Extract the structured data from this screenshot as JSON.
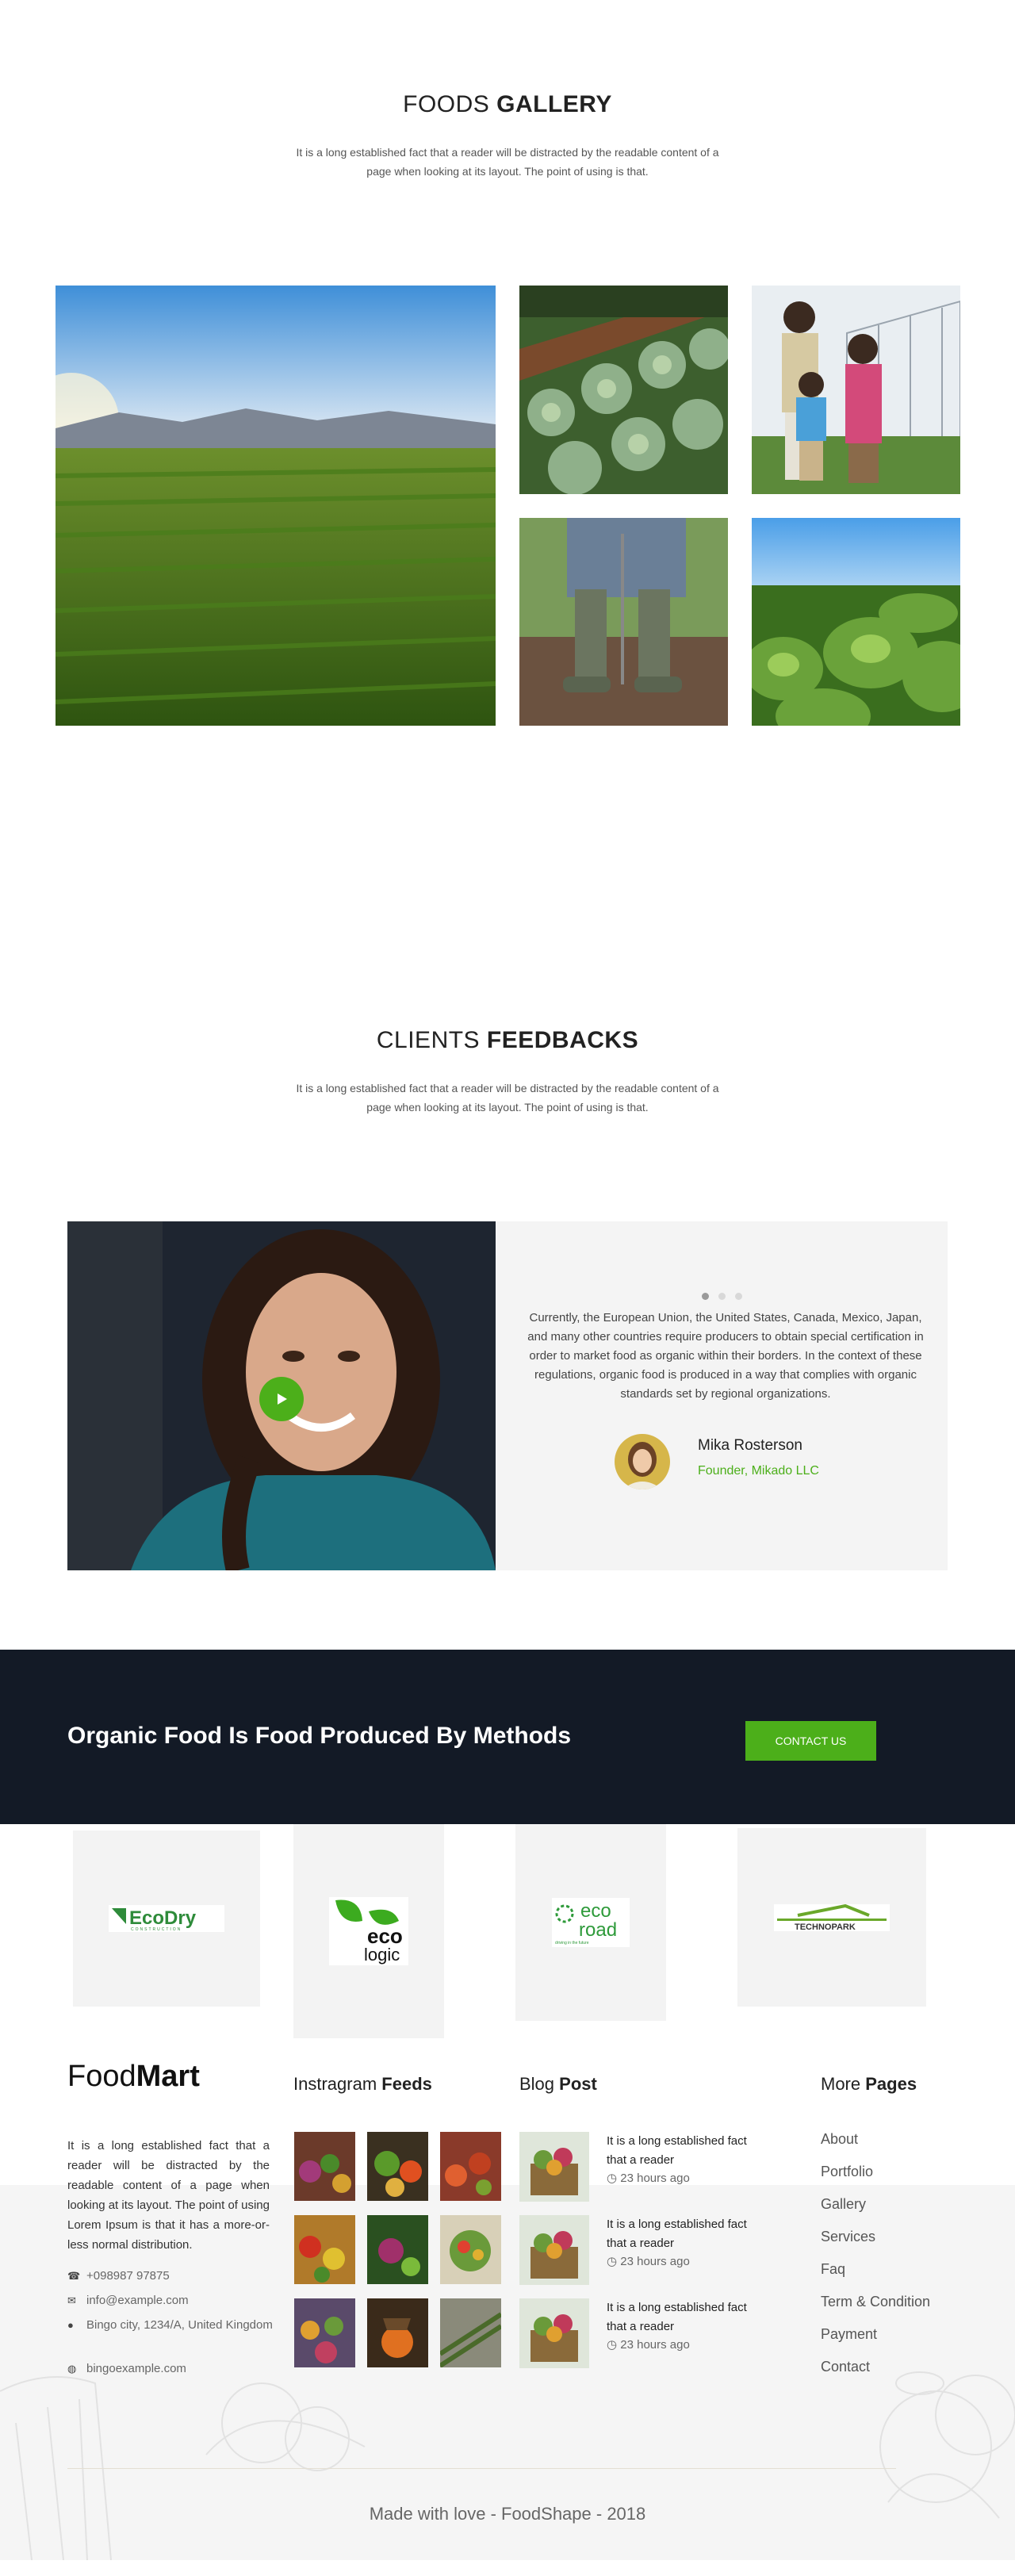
{
  "gallery": {
    "title_light": "FOODS",
    "title_bold": "GALLERY",
    "subtitle": "It is a long established fact that a reader will be distracted by the readable content of a page when looking at its layout. The point of using is that."
  },
  "feedback": {
    "title_light": "CLIENTS",
    "title_bold": "FEEDBACKS",
    "subtitle": "It is a long established fact that a reader will be distracted by the readable content of a page when looking at its layout. The point of using is that.",
    "quote": "Currently, the European Union, the United States, Canada, Mexico, Japan, and many other countries require producers to obtain special certification in order to market food as organic within their borders. In the context of these regulations, organic food is produced in a way that complies with organic standards set by regional organizations.",
    "name": "Mika Rosterson",
    "role": "Founder, Mikado LLC",
    "slides": 3,
    "active_slide": 1
  },
  "cta": {
    "text": "Organic Food Is Food Produced By Methods",
    "button": "CONTACT US"
  },
  "logos": {
    "items": [
      {
        "line1": "EcoDry",
        "line2": "CONSTRUCTION"
      },
      {
        "line1": "eco",
        "line2": "logic"
      },
      {
        "line1": "eco",
        "line2": "road",
        "line3": "driving in the future"
      },
      {
        "line1": "TECHNOPARK"
      }
    ]
  },
  "footer": {
    "brand_light": "Food",
    "brand_bold": "Mart",
    "about": "It is a long established fact that a reader will be distracted by the readable content of a page when looking at its layout. The point of using Lorem Ipsum is that it has a more-or-less normal distribution.",
    "phone": "+098987 97875",
    "email": "info@example.com",
    "address": "Bingo city, 1234/A, United Kingdom",
    "website": "bingoexample.com",
    "insta_title_light": "Instragram",
    "insta_title_bold": "Feeds",
    "blog_title_light": "Blog",
    "blog_title_bold": "Post",
    "posts": [
      {
        "text": "It is a long established fact that a reader",
        "time": "23 hours ago"
      },
      {
        "text": "It is a long established fact that a reader",
        "time": "23 hours ago"
      },
      {
        "text": "It is a long established fact that a reader",
        "time": "23 hours ago"
      }
    ],
    "more_title_light": "More",
    "more_title_bold": "Pages",
    "links": [
      "About",
      "Portfolio",
      "Gallery",
      "Services",
      "Faq",
      "Term & Condition",
      "Payment",
      "Contact"
    ],
    "copyright": "Made with love - FoodShape - 2018"
  },
  "colors": {
    "accent": "#4caf1a",
    "dark": "#131a26"
  }
}
